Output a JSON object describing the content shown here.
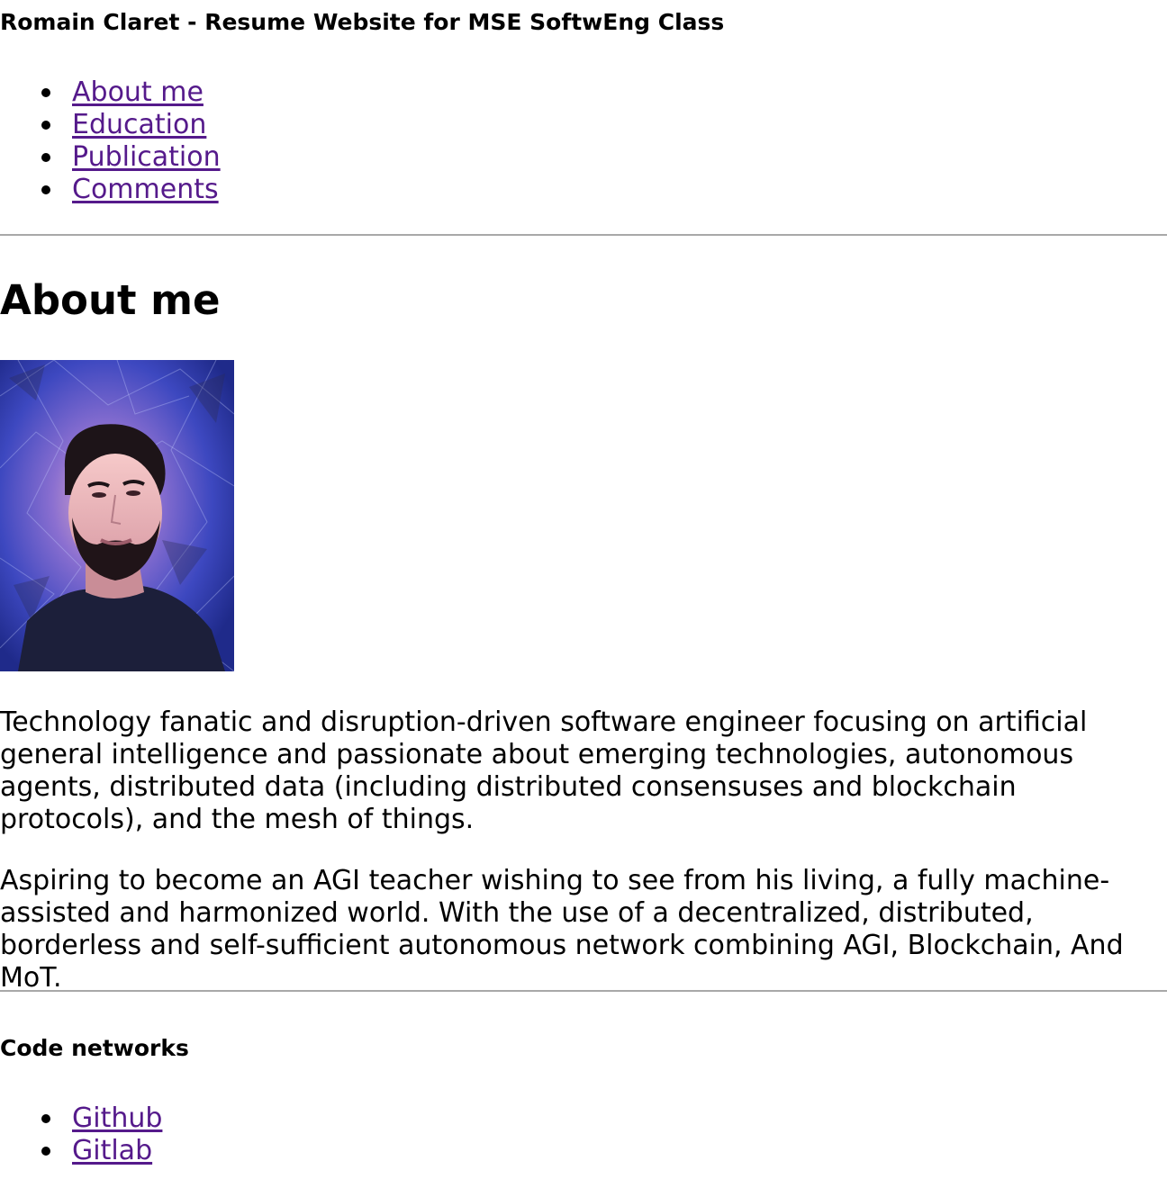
{
  "header": {
    "title": "Romain Claret - Resume Website for MSE SoftwEng Class"
  },
  "nav": {
    "items": [
      {
        "label": "About me"
      },
      {
        "label": "Education"
      },
      {
        "label": "Publication"
      },
      {
        "label": "Comments"
      }
    ]
  },
  "about": {
    "heading": "About me",
    "paragraph1": "Technology fanatic and disruption-driven software engineer focusing on artificial general intelligence and passionate about emerging technologies, autonomous agents, distributed data (including distributed consensuses and blockchain protocols), and the mesh of things.",
    "paragraph2": "Aspiring to become an AGI teacher wishing to see from his living, a fully machine-assisted and harmonized world. With the use of a decentralized, distributed, borderless and self-sufficient autonomous network combining AGI, Blockchain, And MoT."
  },
  "code_networks": {
    "heading": "Code networks",
    "links": [
      {
        "label": "Github"
      },
      {
        "label": "Gitlab"
      }
    ]
  },
  "colors": {
    "link": "#551a8b",
    "divider": "#a8a8a8",
    "portrait_background": "#2b3aa8"
  }
}
